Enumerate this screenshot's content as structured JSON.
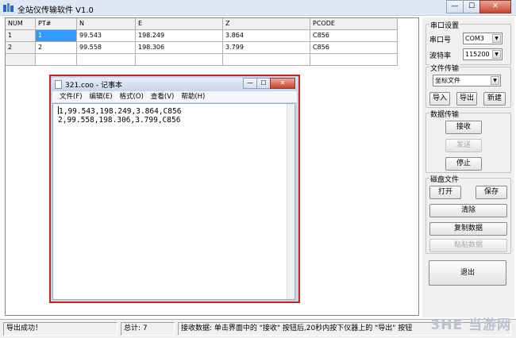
{
  "app": {
    "title": "全站仪传输软件  V1.0"
  },
  "window_buttons": {
    "minimize": "—",
    "maximize": "☐",
    "close": "✕"
  },
  "grid": {
    "columns": [
      "NUM",
      "PT#",
      "N",
      "E",
      "Z",
      "PCODE"
    ],
    "rows": [
      [
        "1",
        "1",
        "99.543",
        "198.249",
        "3.864",
        "C856"
      ],
      [
        "2",
        "2",
        "99.558",
        "198.306",
        "3.799",
        "C856"
      ]
    ],
    "selected_value": "1"
  },
  "serial": {
    "group_title": "串口设置",
    "port_label": "串口号",
    "port_value": "COM3",
    "baud_label": "波特率",
    "baud_value": "115200"
  },
  "file_transfer": {
    "group_title": "文件传输",
    "type_value": "坐标文件",
    "import_label": "导入",
    "export_label": "导出",
    "new_label": "新建"
  },
  "data_transfer": {
    "group_title": "数据传输",
    "receive_label": "接收",
    "send_label": "发送",
    "stop_label": "停止"
  },
  "disk_file": {
    "group_title": "磁盘文件",
    "open_label": "打开",
    "save_label": "保存",
    "clear_label": "清除",
    "copy_label": "复制数据",
    "paste_label": "粘贴数据"
  },
  "exit_label": "退出",
  "notepad": {
    "title": "321.coo - 记事本",
    "menu": [
      "文件(F)",
      "编辑(E)",
      "格式(O)",
      "查看(V)",
      "帮助(H)"
    ],
    "lines": [
      "1,99.543,198.249,3.864,C856",
      "2,99.558,198.306,3.799,C856"
    ]
  },
  "status": {
    "message": "导出成功！",
    "total": "总计: 7",
    "hint": "接收数据: 单击界面中的 \"接收\" 按钮后,20秒内按下仪器上的 \"导出\" 按钮"
  },
  "watermark": "3HE 当游网"
}
